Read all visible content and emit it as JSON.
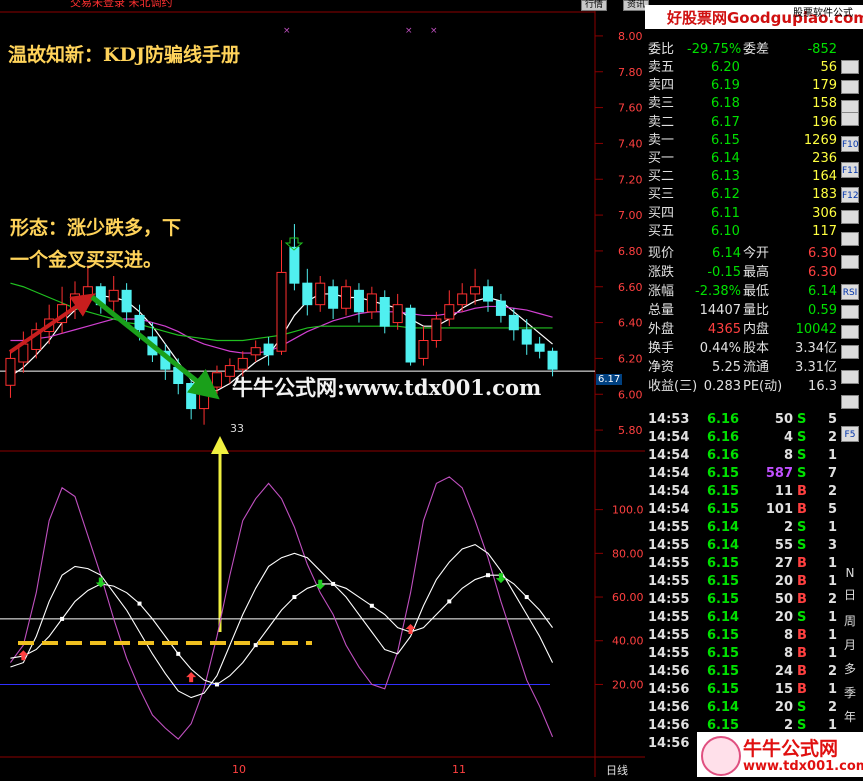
{
  "header": {
    "top_left": "交易未登录  未北调约",
    "tabs": [
      "行情",
      "资讯"
    ],
    "brand": "好股票网Goodgupiao.com",
    "brand_right": "股票软件公式"
  },
  "annotations": {
    "title": "温故知新：KDJ防骗线手册",
    "form_note_line1": "形态：涨少跌多，下",
    "form_note_line2": "一个金叉买买进。",
    "watermark": "牛牛公式网:www.tdx001.com",
    "low_label": "33"
  },
  "chart_data": [
    {
      "type": "candlestick",
      "price_axis": [
        8.0,
        7.8,
        7.6,
        7.4,
        7.2,
        7.0,
        6.8,
        6.6,
        6.4,
        6.2,
        6.0,
        5.8
      ],
      "y_range": [
        5.7,
        8.1
      ],
      "current_price_tag": "6.17",
      "low_marker": 5.83,
      "candles": [
        {
          "o": 6.05,
          "c": 6.2,
          "h": 6.24,
          "l": 5.98
        },
        {
          "o": 6.18,
          "c": 6.28,
          "h": 6.35,
          "l": 6.12
        },
        {
          "o": 6.25,
          "c": 6.36,
          "h": 6.4,
          "l": 6.2
        },
        {
          "o": 6.35,
          "c": 6.42,
          "h": 6.5,
          "l": 6.28
        },
        {
          "o": 6.4,
          "c": 6.5,
          "h": 6.6,
          "l": 6.34
        },
        {
          "o": 6.48,
          "c": 6.56,
          "h": 6.63,
          "l": 6.42
        },
        {
          "o": 6.55,
          "c": 6.6,
          "h": 6.72,
          "l": 6.5
        },
        {
          "o": 6.6,
          "c": 6.5,
          "h": 6.62,
          "l": 6.45
        },
        {
          "o": 6.52,
          "c": 6.58,
          "h": 6.66,
          "l": 6.46
        },
        {
          "o": 6.58,
          "c": 6.46,
          "h": 6.62,
          "l": 6.4
        },
        {
          "o": 6.44,
          "c": 6.36,
          "h": 6.5,
          "l": 6.3
        },
        {
          "o": 6.32,
          "c": 6.22,
          "h": 6.4,
          "l": 6.18
        },
        {
          "o": 6.24,
          "c": 6.14,
          "h": 6.28,
          "l": 6.08
        },
        {
          "o": 6.15,
          "c": 6.06,
          "h": 6.2,
          "l": 6.0
        },
        {
          "o": 6.06,
          "c": 5.92,
          "h": 6.08,
          "l": 5.86
        },
        {
          "o": 5.92,
          "c": 6.06,
          "h": 6.1,
          "l": 5.83
        },
        {
          "o": 6.04,
          "c": 6.12,
          "h": 6.16,
          "l": 6.0
        },
        {
          "o": 6.1,
          "c": 6.16,
          "h": 6.2,
          "l": 6.06
        },
        {
          "o": 6.14,
          "c": 6.2,
          "h": 6.24,
          "l": 6.1
        },
        {
          "o": 6.22,
          "c": 6.26,
          "h": 6.3,
          "l": 6.18
        },
        {
          "o": 6.28,
          "c": 6.22,
          "h": 6.32,
          "l": 6.16
        },
        {
          "o": 6.24,
          "c": 6.68,
          "h": 6.86,
          "l": 6.22
        },
        {
          "o": 6.82,
          "c": 6.62,
          "h": 6.95,
          "l": 6.58
        },
        {
          "o": 6.62,
          "c": 6.5,
          "h": 6.7,
          "l": 6.44
        },
        {
          "o": 6.5,
          "c": 6.62,
          "h": 6.66,
          "l": 6.46
        },
        {
          "o": 6.6,
          "c": 6.48,
          "h": 6.64,
          "l": 6.42
        },
        {
          "o": 6.48,
          "c": 6.6,
          "h": 6.64,
          "l": 6.44
        },
        {
          "o": 6.58,
          "c": 6.46,
          "h": 6.62,
          "l": 6.4
        },
        {
          "o": 6.46,
          "c": 6.56,
          "h": 6.6,
          "l": 6.42
        },
        {
          "o": 6.54,
          "c": 6.38,
          "h": 6.58,
          "l": 6.34
        },
        {
          "o": 6.4,
          "c": 6.5,
          "h": 6.56,
          "l": 6.36
        },
        {
          "o": 6.48,
          "c": 6.18,
          "h": 6.5,
          "l": 6.16
        },
        {
          "o": 6.2,
          "c": 6.3,
          "h": 6.38,
          "l": 6.16
        },
        {
          "o": 6.3,
          "c": 6.42,
          "h": 6.46,
          "l": 6.26
        },
        {
          "o": 6.42,
          "c": 6.5,
          "h": 6.58,
          "l": 6.38
        },
        {
          "o": 6.5,
          "c": 6.56,
          "h": 6.62,
          "l": 6.46
        },
        {
          "o": 6.56,
          "c": 6.6,
          "h": 6.7,
          "l": 6.5
        },
        {
          "o": 6.6,
          "c": 6.52,
          "h": 6.64,
          "l": 6.46
        },
        {
          "o": 6.52,
          "c": 6.44,
          "h": 6.56,
          "l": 6.4
        },
        {
          "o": 6.44,
          "c": 6.36,
          "h": 6.48,
          "l": 6.3
        },
        {
          "o": 6.36,
          "c": 6.28,
          "h": 6.42,
          "l": 6.22
        },
        {
          "o": 6.28,
          "c": 6.24,
          "h": 6.32,
          "l": 6.2
        },
        {
          "o": 6.24,
          "c": 6.14,
          "h": 6.26,
          "l": 6.1
        }
      ],
      "ma_series": [
        {
          "color": "#ffffff",
          "values": [
            6.1,
            6.15,
            6.22,
            6.3,
            6.4,
            6.47,
            6.52,
            6.55,
            6.54,
            6.52,
            6.46,
            6.38,
            6.28,
            6.18,
            6.08,
            6.02,
            6.02,
            6.06,
            6.12,
            6.18,
            6.22,
            6.32,
            6.44,
            6.52,
            6.56,
            6.56,
            6.54,
            6.54,
            6.52,
            6.5,
            6.48,
            6.42,
            6.38,
            6.38,
            6.42,
            6.48,
            6.52,
            6.54,
            6.52,
            6.46,
            6.4,
            6.34,
            6.28
          ]
        },
        {
          "color": "#d040d0",
          "values": [
            6.3,
            6.3,
            6.31,
            6.32,
            6.34,
            6.36,
            6.38,
            6.4,
            6.42,
            6.42,
            6.42,
            6.4,
            6.38,
            6.35,
            6.31,
            6.28,
            6.26,
            6.24,
            6.23,
            6.23,
            6.24,
            6.27,
            6.31,
            6.35,
            6.38,
            6.41,
            6.43,
            6.45,
            6.46,
            6.46,
            6.46,
            6.45,
            6.44,
            6.44,
            6.45,
            6.46,
            6.48,
            6.49,
            6.49,
            6.48,
            6.47,
            6.45,
            6.43
          ]
        },
        {
          "color": "#20c020",
          "values": [
            6.62,
            6.6,
            6.57,
            6.54,
            6.51,
            6.48,
            6.46,
            6.44,
            6.42,
            6.4,
            6.39,
            6.37,
            6.35,
            6.33,
            6.32,
            6.31,
            6.3,
            6.3,
            6.3,
            6.31,
            6.32,
            6.33,
            6.35,
            6.37,
            6.38,
            6.38,
            6.38,
            6.38,
            6.38,
            6.38,
            6.38,
            6.37,
            6.37,
            6.37,
            6.37,
            6.37,
            6.37,
            6.37,
            6.37,
            6.37,
            6.37,
            6.37,
            6.37
          ]
        }
      ]
    },
    {
      "type": "line",
      "name": "KDJ",
      "y_axis": [
        100.0,
        80.0,
        60.0,
        40.0,
        20.0
      ],
      "y_range": [
        -10,
        125
      ],
      "ref_lines": [
        50,
        20
      ],
      "series": [
        {
          "color": "#c050c0",
          "values": [
            30,
            38,
            62,
            95,
            110,
            106,
            88,
            70,
            50,
            32,
            18,
            6,
            0,
            -5,
            2,
            18,
            42,
            70,
            95,
            105,
            112,
            105,
            92,
            75,
            62,
            52,
            38,
            28,
            20,
            18,
            35,
            62,
            95,
            112,
            115,
            110,
            95,
            78,
            58,
            40,
            22,
            10,
            -4
          ]
        },
        {
          "color": "#ffffff",
          "values": [
            28,
            30,
            42,
            58,
            70,
            74,
            73,
            70,
            62,
            54,
            44,
            34,
            25,
            17,
            14,
            16,
            24,
            38,
            52,
            64,
            74,
            78,
            80,
            78,
            72,
            66,
            60,
            52,
            44,
            36,
            34,
            42,
            56,
            68,
            76,
            82,
            84,
            80,
            72,
            62,
            52,
            42,
            30
          ]
        },
        {
          "color": "#ffffff",
          "values": [
            32,
            33,
            36,
            42,
            50,
            58,
            63,
            66,
            65,
            62,
            57,
            50,
            42,
            34,
            27,
            22,
            20,
            24,
            30,
            38,
            46,
            54,
            60,
            64,
            66,
            66,
            64,
            60,
            56,
            52,
            46,
            44,
            46,
            52,
            58,
            64,
            68,
            70,
            70,
            66,
            60,
            54,
            46
          ]
        }
      ],
      "markers": [
        {
          "index": 1,
          "type": "golden",
          "value": 32
        },
        {
          "index": 14,
          "type": "golden",
          "value": 22
        },
        {
          "index": 31,
          "type": "golden",
          "value": 44
        },
        {
          "index": 7,
          "type": "dead",
          "value": 68
        },
        {
          "index": 24,
          "type": "dead",
          "value": 67
        },
        {
          "index": 38,
          "type": "dead",
          "value": 70
        }
      ]
    }
  ],
  "xaxis": {
    "labels": [
      "10",
      "11"
    ],
    "label_right": "日线"
  },
  "quote": {
    "weibi_label": "委比",
    "weibi_val": "-29.75%",
    "weicha_label": "委差",
    "weicha_val": "-852",
    "sell": [
      {
        "name": "卖五",
        "price": "6.20",
        "vol": "56"
      },
      {
        "name": "卖四",
        "price": "6.19",
        "vol": "179"
      },
      {
        "name": "卖三",
        "price": "6.18",
        "vol": "158"
      },
      {
        "name": "卖二",
        "price": "6.17",
        "vol": "196"
      },
      {
        "name": "卖一",
        "price": "6.15",
        "vol": "1269"
      }
    ],
    "buy": [
      {
        "name": "买一",
        "price": "6.14",
        "vol": "236"
      },
      {
        "name": "买二",
        "price": "6.13",
        "vol": "164"
      },
      {
        "name": "买三",
        "price": "6.12",
        "vol": "183"
      },
      {
        "name": "买四",
        "price": "6.11",
        "vol": "306"
      },
      {
        "name": "买五",
        "price": "6.10",
        "vol": "117"
      }
    ],
    "stats": [
      {
        "l1": "现价",
        "v1": "6.14",
        "l2": "今开",
        "v2": "6.30",
        "c1": "#00e000",
        "c2": "#ff4040"
      },
      {
        "l1": "涨跌",
        "v1": "-0.15",
        "l2": "最高",
        "v2": "6.30",
        "c1": "#00e000",
        "c2": "#ff4040"
      },
      {
        "l1": "涨幅",
        "v1": "-2.38%",
        "l2": "最低",
        "v2": "6.14",
        "c1": "#00e000",
        "c2": "#00e000"
      },
      {
        "l1": "总量",
        "v1": "14407",
        "l2": "量比",
        "v2": "0.59",
        "c1": "#e0e0e0",
        "c2": "#00e000"
      },
      {
        "l1": "外盘",
        "v1": "4365",
        "l2": "内盘",
        "v2": "10042",
        "c1": "#ff4040",
        "c2": "#00e000"
      },
      {
        "l1": "换手",
        "v1": "0.44%",
        "l2": "股本",
        "v2": "3.34亿",
        "c1": "#e0e0e0",
        "c2": "#e0e0e0"
      },
      {
        "l1": "净资",
        "v1": "5.25",
        "l2": "流通",
        "v2": "3.31亿",
        "c1": "#e0e0e0",
        "c2": "#e0e0e0"
      },
      {
        "l1": "收益(三)",
        "v1": "0.283",
        "l2": "PE(动)",
        "v2": "16.3",
        "c1": "#e0e0e0",
        "c2": "#e0e0e0"
      }
    ],
    "ticks": [
      {
        "t": "14:53",
        "p": "6.16",
        "v": "50",
        "d": "S",
        "n": "5"
      },
      {
        "t": "14:54",
        "p": "6.16",
        "v": "4",
        "d": "S",
        "n": "2"
      },
      {
        "t": "14:54",
        "p": "6.16",
        "v": "8",
        "d": "S",
        "n": "1"
      },
      {
        "t": "14:54",
        "p": "6.15",
        "v": "587",
        "d": "S",
        "n": "7"
      },
      {
        "t": "14:54",
        "p": "6.15",
        "v": "11",
        "d": "B",
        "n": "2"
      },
      {
        "t": "14:54",
        "p": "6.15",
        "v": "101",
        "d": "B",
        "n": "5"
      },
      {
        "t": "14:55",
        "p": "6.14",
        "v": "2",
        "d": "S",
        "n": "1"
      },
      {
        "t": "14:55",
        "p": "6.14",
        "v": "55",
        "d": "S",
        "n": "3"
      },
      {
        "t": "14:55",
        "p": "6.15",
        "v": "27",
        "d": "B",
        "n": "1"
      },
      {
        "t": "14:55",
        "p": "6.15",
        "v": "20",
        "d": "B",
        "n": "1"
      },
      {
        "t": "14:55",
        "p": "6.15",
        "v": "50",
        "d": "B",
        "n": "2"
      },
      {
        "t": "14:55",
        "p": "6.14",
        "v": "20",
        "d": "S",
        "n": "1"
      },
      {
        "t": "14:55",
        "p": "6.15",
        "v": "8",
        "d": "B",
        "n": "1"
      },
      {
        "t": "14:55",
        "p": "6.15",
        "v": "8",
        "d": "B",
        "n": "1"
      },
      {
        "t": "14:56",
        "p": "6.15",
        "v": "24",
        "d": "B",
        "n": "2"
      },
      {
        "t": "14:56",
        "p": "6.15",
        "v": "15",
        "d": "B",
        "n": "1"
      },
      {
        "t": "14:56",
        "p": "6.14",
        "v": "20",
        "d": "S",
        "n": "2"
      },
      {
        "t": "14:56",
        "p": "6.15",
        "v": "2",
        "d": "S",
        "n": "1"
      },
      {
        "t": "14:56",
        "p": "6.14",
        "v": "",
        "d": "",
        "n": ""
      }
    ],
    "tick_colors": {
      "up": "#ff4040",
      "down": "#00e000",
      "flat": "#e0e0e0"
    }
  },
  "side_tools": [
    "F10",
    "F11",
    "F12",
    "RSI",
    "F5",
    "N",
    "日",
    "周",
    "月",
    "多",
    "季",
    "年"
  ],
  "logo": {
    "text": "牛牛公式网",
    "url": "www.tdx001.com"
  },
  "colors": {
    "up": "#ff3030",
    "down": "#50f0f0",
    "grid": "#8b0000",
    "axis_text": "#ff4040",
    "kdj_k": "#c050c0"
  }
}
